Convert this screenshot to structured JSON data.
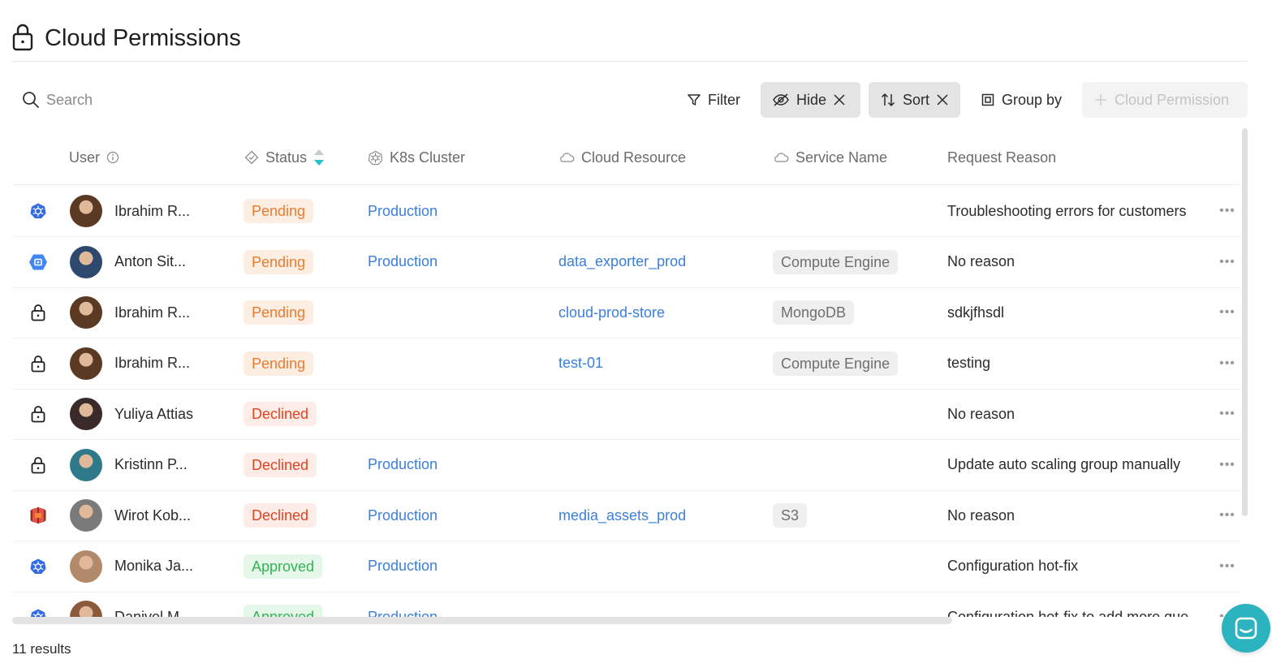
{
  "page": {
    "title": "Cloud Permissions"
  },
  "toolbar": {
    "search_placeholder": "Search",
    "filter_label": "Filter",
    "hide_label": "Hide",
    "sort_label": "Sort",
    "group_by_label": "Group by",
    "add_label": "Cloud Permission"
  },
  "columns": {
    "user": "User",
    "status": "Status",
    "k8s_cluster": "K8s Cluster",
    "cloud_resource": "Cloud Resource",
    "service_name": "Service Name",
    "request_reason": "Request Reason"
  },
  "rows": [
    {
      "icon": "kubernetes-icon",
      "user": "Ibrahim R...",
      "status": "Pending",
      "status_type": "pending",
      "cluster": "Production",
      "resource": "",
      "service": "",
      "reason": "Troubleshooting errors for customers",
      "avatar_color": "#5a3a22"
    },
    {
      "icon": "gcp-icon",
      "user": "Anton Sit...",
      "status": "Pending",
      "status_type": "pending",
      "cluster": "Production",
      "resource": "data_exporter_prod",
      "service": "Compute Engine",
      "reason": "No reason",
      "avatar_color": "#2d4a6e"
    },
    {
      "icon": "lock-icon",
      "user": "Ibrahim R...",
      "status": "Pending",
      "status_type": "pending",
      "cluster": "",
      "resource": "cloud-prod-store",
      "service": "MongoDB",
      "reason": "sdkjfhsdl",
      "avatar_color": "#5a3a22"
    },
    {
      "icon": "lock-icon",
      "user": "Ibrahim R...",
      "status": "Pending",
      "status_type": "pending",
      "cluster": "",
      "resource": "test-01",
      "service": "Compute Engine",
      "reason": "testing",
      "avatar_color": "#5a3a22"
    },
    {
      "icon": "lock-icon",
      "user": "Yuliya Attias",
      "status": "Declined",
      "status_type": "declined",
      "cluster": "",
      "resource": "",
      "service": "",
      "reason": "No reason",
      "avatar_color": "#3a2a2a"
    },
    {
      "icon": "lock-icon",
      "user": "Kristinn P...",
      "status": "Declined",
      "status_type": "declined",
      "cluster": "Production",
      "resource": "",
      "service": "",
      "reason": "Update auto scaling group manually",
      "avatar_color": "#2f7a8a"
    },
    {
      "icon": "aws-s3-icon",
      "user": "Wirot Kob...",
      "status": "Declined",
      "status_type": "declined",
      "cluster": "Production",
      "resource": "media_assets_prod",
      "service": "S3",
      "reason": "No reason",
      "avatar_color": "#7a7a7a"
    },
    {
      "icon": "kubernetes-icon",
      "user": "Monika Ja...",
      "status": "Approved",
      "status_type": "approved",
      "cluster": "Production",
      "resource": "",
      "service": "",
      "reason": "Configuration hot-fix",
      "avatar_color": "#b08a6a"
    },
    {
      "icon": "kubernetes-icon",
      "user": "Danivel M...",
      "status": "Approved",
      "status_type": "approved",
      "cluster": "Production",
      "resource": "",
      "service": "",
      "reason": "Configuration hot-fix to add more que...",
      "avatar_color": "#8a5a3a"
    }
  ],
  "footer": {
    "results": "11 results"
  },
  "colors": {
    "accent": "#3b7fd8",
    "pending": "#ec7b2d",
    "declined": "#e2441f",
    "approved": "#34b454",
    "chat": "#2bb3c0"
  }
}
